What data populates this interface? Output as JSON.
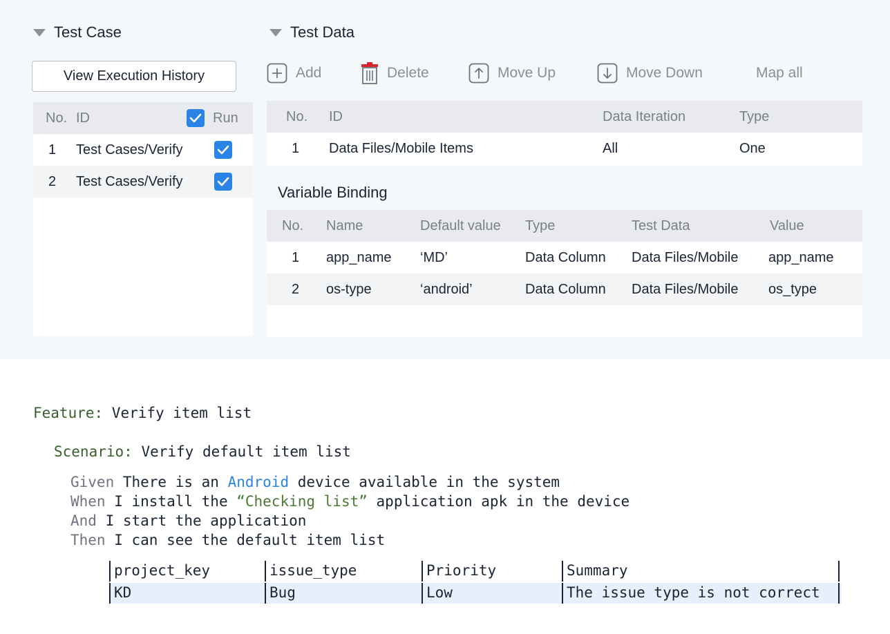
{
  "test_case": {
    "title": "Test Case",
    "view_history_label": "View Execution History",
    "columns": {
      "no": "No.",
      "id": "ID",
      "run": "Run"
    },
    "rows": [
      {
        "no": "1",
        "id": "Test Cases/Verify",
        "run": true
      },
      {
        "no": "2",
        "id": "Test Cases/Verify",
        "run": true
      }
    ]
  },
  "test_data": {
    "title": "Test Data",
    "toolbar": {
      "add": "Add",
      "delete": "Delete",
      "move_up": "Move Up",
      "move_down": "Move Down",
      "map_all": "Map all"
    },
    "columns": {
      "no": "No.",
      "id": "ID",
      "iteration": "Data Iteration",
      "type": "Type"
    },
    "rows": [
      {
        "no": "1",
        "id": "Data Files/Mobile Items",
        "iteration": "All",
        "type": "One"
      }
    ]
  },
  "variable_binding": {
    "title": "Variable Binding",
    "columns": {
      "no": "No.",
      "name": "Name",
      "default": "Default value",
      "type": "Type",
      "test_data": "Test Data",
      "value": "Value"
    },
    "rows": [
      {
        "no": "1",
        "name": "app_name",
        "default": "‘MD’",
        "type": "Data Column",
        "test_data": "Data Files/Mobile",
        "value": "app_name"
      },
      {
        "no": "2",
        "name": "os-type",
        "default": "‘android’",
        "type": "Data Column",
        "test_data": "Data Files/Mobile",
        "value": "os_type"
      }
    ]
  },
  "gherkin": {
    "feature_kw": "Feature:",
    "feature_text": " Verify item list",
    "scenario_kw": "Scenario:",
    "scenario_text": " Verify default item list",
    "given_kw": "Given",
    "given_a": " There is an ",
    "given_hl": "Android",
    "given_b": " device available in the system",
    "when_kw": "When",
    "when_a": " I install the ",
    "when_str": "“Checking list”",
    "when_b": " application apk in the device",
    "and_kw": "And",
    "and_text": " I start the application",
    "then_kw": "Then",
    "then_text": " I can see the default item list",
    "table": {
      "headers": [
        "project_key",
        "issue_type",
        "Priority",
        "Summary"
      ],
      "row": [
        "KD",
        "Bug",
        "Low",
        "The issue type is not correct"
      ]
    }
  },
  "colors": {
    "accent": "#2a84e6",
    "top_bg": "#f5f8fb",
    "header_bg": "#e8eaed"
  }
}
